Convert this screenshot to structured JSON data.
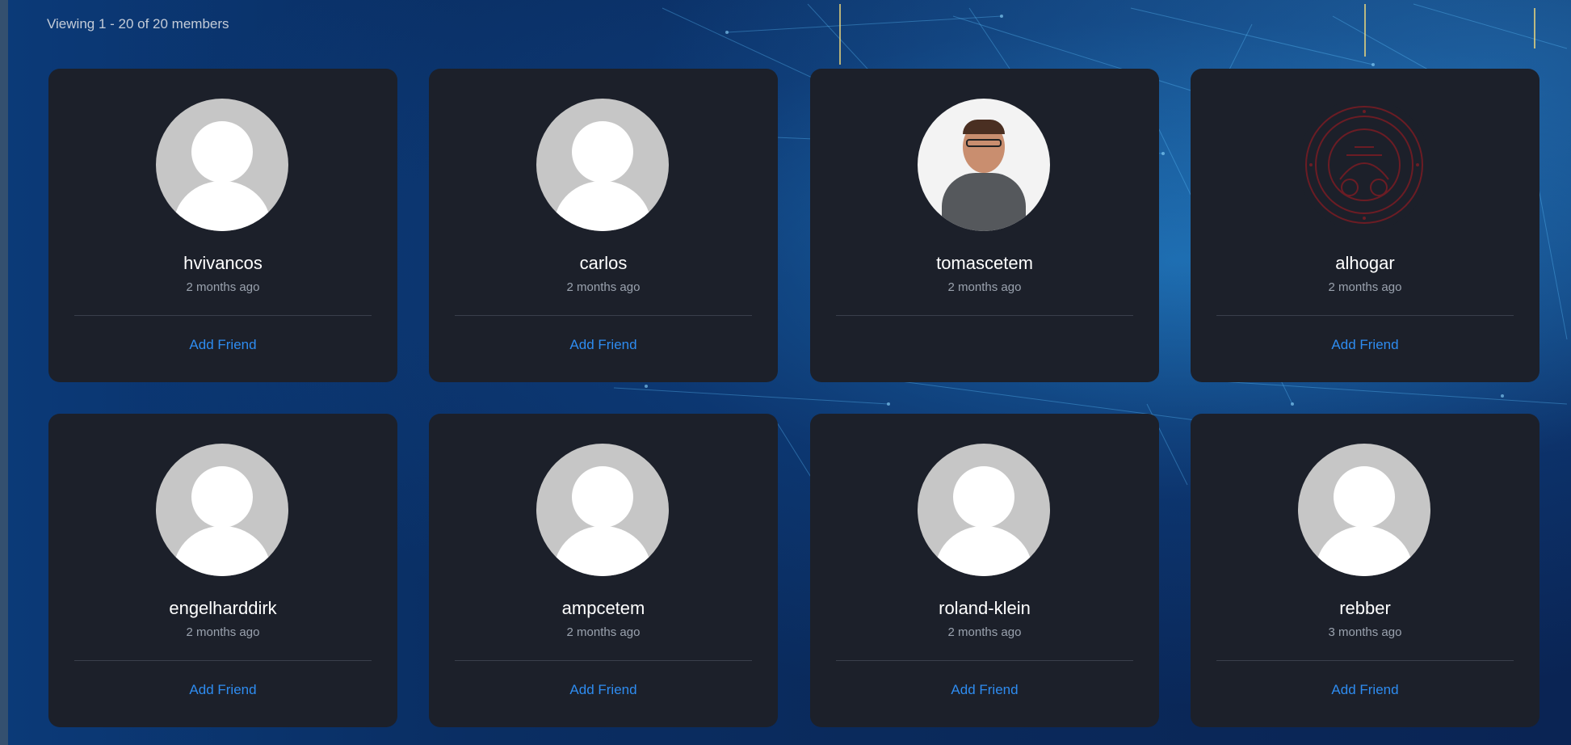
{
  "header": {
    "viewing_text": "Viewing 1 - 20 of 20 members"
  },
  "colors": {
    "card_bg": "#1c202a",
    "accent": "#2e8cf0",
    "muted": "#9aa2ae"
  },
  "members": [
    {
      "name": "hvivancos",
      "time": "2 months ago",
      "action": "Add Friend",
      "avatar": "default-avatar-icon"
    },
    {
      "name": "carlos",
      "time": "2 months ago",
      "action": "Add Friend",
      "avatar": "default-avatar-icon"
    },
    {
      "name": "tomascetem",
      "time": "2 months ago",
      "action": "",
      "avatar": "profile-photo"
    },
    {
      "name": "alhogar",
      "time": "2 months ago",
      "action": "Add Friend",
      "avatar": "university-seal-logo"
    },
    {
      "name": "engelharddirk",
      "time": "2 months ago",
      "action": "Add Friend",
      "avatar": "default-avatar-icon"
    },
    {
      "name": "ampcetem",
      "time": "2 months ago",
      "action": "Add Friend",
      "avatar": "default-avatar-icon"
    },
    {
      "name": "roland-klein",
      "time": "2 months ago",
      "action": "Add Friend",
      "avatar": "default-avatar-icon"
    },
    {
      "name": "rebber",
      "time": "3 months ago",
      "action": "Add Friend",
      "avatar": "default-avatar-icon"
    }
  ]
}
